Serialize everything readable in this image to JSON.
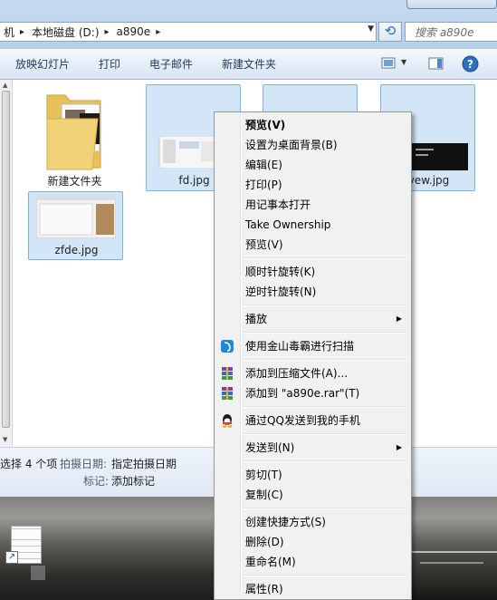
{
  "breadcrumb": [
    {
      "label": "机"
    },
    {
      "label": "本地磁盘 (D:)"
    },
    {
      "label": "a890e"
    }
  ],
  "search": {
    "placeholder": "搜索 a890e"
  },
  "toolbar": {
    "buttons": [
      {
        "label": "放映幻灯片"
      },
      {
        "label": "打印"
      },
      {
        "label": "电子邮件"
      },
      {
        "label": "新建文件夹"
      }
    ]
  },
  "files": [
    {
      "name": "新建文件夹",
      "type": "folder"
    },
    {
      "name": "fd.jpg",
      "type": "image"
    },
    {
      "name": "",
      "type": "image"
    },
    {
      "name": "vew.jpg",
      "type": "image"
    },
    {
      "name": "zfde.jpg",
      "type": "image"
    }
  ],
  "status": {
    "selected_count": "选择 4 个项",
    "date_label": "拍摄日期:",
    "date_value": "指定拍摄日期",
    "tag_label": "标记:",
    "tag_value": "添加标记"
  },
  "context_menu": {
    "items": [
      {
        "label": "预览(V)",
        "bold": true
      },
      {
        "label": "设置为桌面背景(B)"
      },
      {
        "label": "编辑(E)"
      },
      {
        "label": "打印(P)"
      },
      {
        "label": "用记事本打开"
      },
      {
        "label": "Take Ownership"
      },
      {
        "label": "预览(V)"
      },
      {
        "label": "顺时针旋转(K)"
      },
      {
        "label": "逆时针旋转(N)"
      },
      {
        "label": "播放",
        "submenu": true
      },
      {
        "label": "使用金山毒霸进行扫描",
        "icon": "duba-icon"
      },
      {
        "label": "添加到压缩文件(A)...",
        "icon": "winrar-icon"
      },
      {
        "label": "添加到 \"a890e.rar\"(T)",
        "icon": "winrar-icon"
      },
      {
        "label": "通过QQ发送到我的手机",
        "icon": "qq-icon"
      },
      {
        "label": "发送到(N)",
        "submenu": true
      },
      {
        "label": "剪切(T)"
      },
      {
        "label": "复制(C)"
      },
      {
        "label": "创建快捷方式(S)"
      },
      {
        "label": "删除(D)"
      },
      {
        "label": "重命名(M)"
      },
      {
        "label": "属性(R)"
      }
    ]
  },
  "colors": {
    "selection": "#d2e6f8",
    "menu_bg": "#f1f1f1",
    "toolbar_text": "#1e395b"
  }
}
